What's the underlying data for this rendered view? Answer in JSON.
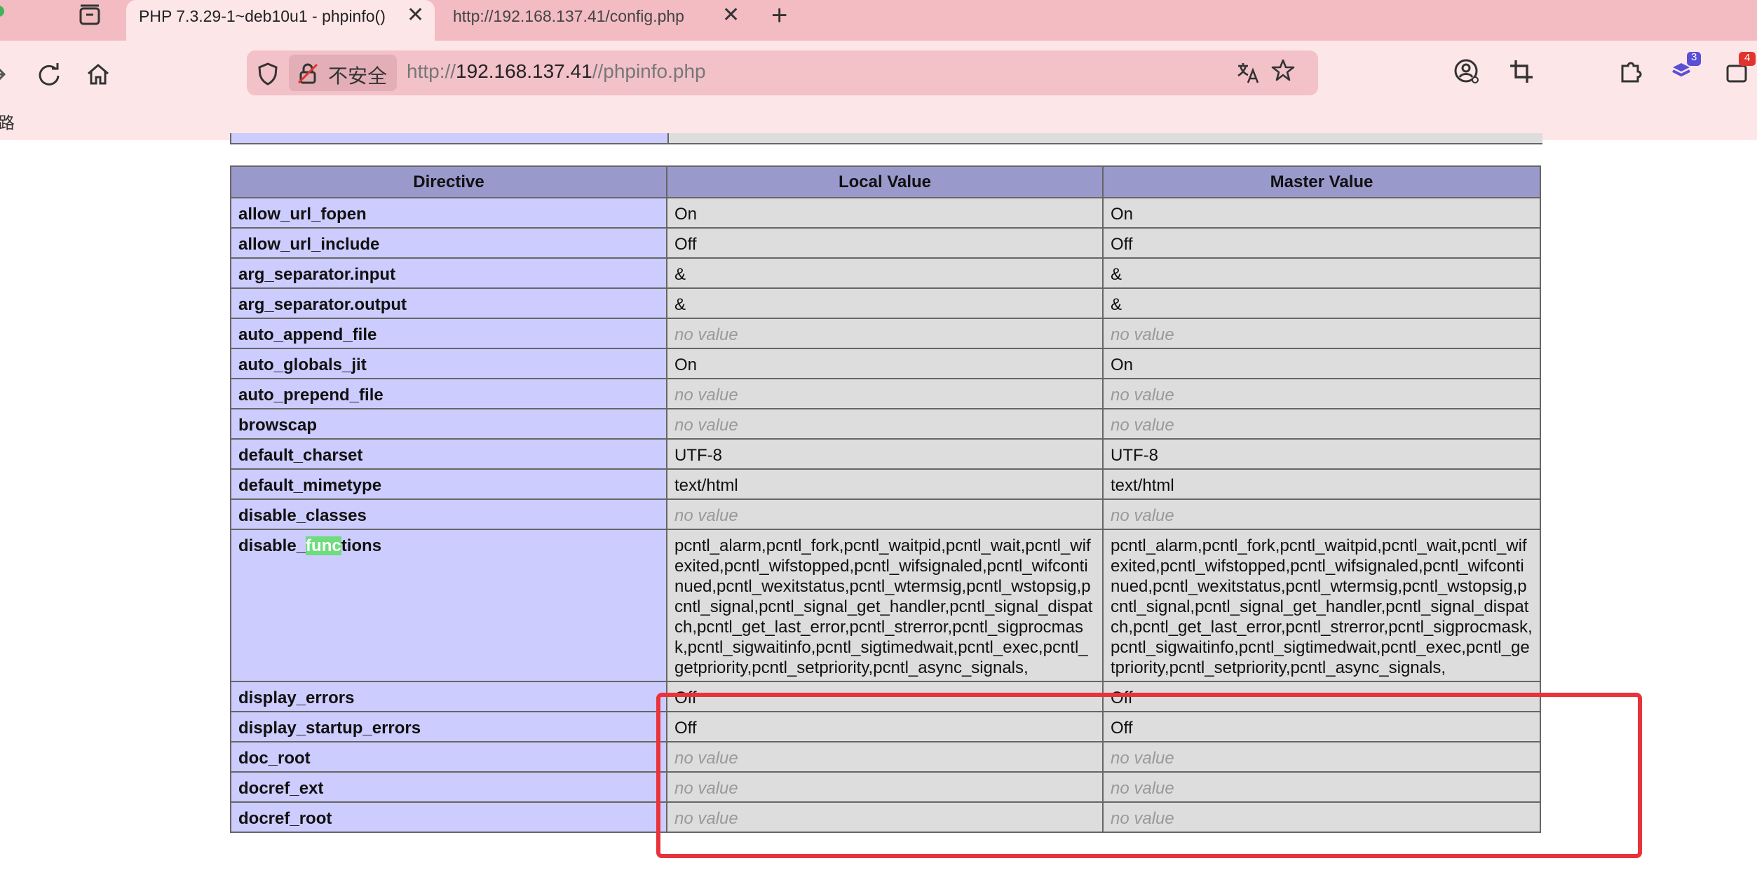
{
  "browser": {
    "active_tab_title": "PHP 7.3.29-1~deb10u1 - phpinfo()",
    "second_tab_title": "http://192.168.137.41/config.php",
    "tab_close_glyph": "✕",
    "new_tab_glyph": "+",
    "security_label": "不安全",
    "url_scheme": "http://",
    "url_host": "192.168.137.41",
    "url_path": "//phpinfo.php",
    "bookmark_partial": "է路",
    "badges": {
      "ext_badge_1": "3",
      "ext_badge_2": "4"
    },
    "colors": {
      "chrome": "#f6c9ce",
      "tab_active": "#fde6e8",
      "badge_blue": "#5b4fd6",
      "badge_red": "#e0342c"
    }
  },
  "table": {
    "headers": [
      "Directive",
      "Local Value",
      "Master Value"
    ],
    "no_value_label": "no value",
    "rows": [
      {
        "directive": "allow_url_fopen",
        "local": "On",
        "master": "On"
      },
      {
        "directive": "allow_url_include",
        "local": "Off",
        "master": "Off"
      },
      {
        "directive": "arg_separator.input",
        "local": "&",
        "master": "&"
      },
      {
        "directive": "arg_separator.output",
        "local": "&",
        "master": "&"
      },
      {
        "directive": "auto_append_file",
        "local": "no value",
        "master": "no value"
      },
      {
        "directive": "auto_globals_jit",
        "local": "On",
        "master": "On"
      },
      {
        "directive": "auto_prepend_file",
        "local": "no value",
        "master": "no value"
      },
      {
        "directive": "browscap",
        "local": "no value",
        "master": "no value"
      },
      {
        "directive": "default_charset",
        "local": "UTF-8",
        "master": "UTF-8"
      },
      {
        "directive": "default_mimetype",
        "local": "text/html",
        "master": "text/html"
      },
      {
        "directive": "disable_classes",
        "local": "no value",
        "master": "no value"
      }
    ],
    "disable_functions": {
      "directive_prefix": "disable_",
      "directive_highlight": "func",
      "directive_suffix": "tions",
      "local": "pcntl_alarm,pcntl_fork,pcntl_waitpid,pcntl_wait,pcntl_wifexited,pcntl_wifstopped,pcntl_wifsignaled,pcntl_wifcontinued,pcntl_wexitstatus,pcntl_wtermsig,pcntl_wstopsig,pcntl_signal,pcntl_signal_get_handler,pcntl_signal_dispatch,pcntl_get_last_error,pcntl_strerror,pcntl_sigprocmask,pcntl_sigwaitinfo,pcntl_sigtimedwait,pcntl_exec,pcntl_getpriority,pcntl_setpriority,pcntl_async_signals,",
      "master": "pcntl_alarm,pcntl_fork,pcntl_waitpid,pcntl_wait,pcntl_wifexited,pcntl_wifstopped,pcntl_wifsignaled,pcntl_wifcontinued,pcntl_wexitstatus,pcntl_wtermsig,pcntl_wstopsig,pcntl_signal,pcntl_signal_get_handler,pcntl_signal_dispatch,pcntl_get_last_error,pcntl_strerror,pcntl_sigprocmask,pcntl_sigwaitinfo,pcntl_sigtimedwait,pcntl_exec,pcntl_getpriority,pcntl_setpriority,pcntl_async_signals,"
    },
    "rows_after": [
      {
        "directive": "display_errors",
        "local": "Off",
        "master": "Off"
      },
      {
        "directive": "display_startup_errors",
        "local": "Off",
        "master": "Off"
      },
      {
        "directive": "doc_root",
        "local": "no value",
        "master": "no value"
      },
      {
        "directive": "docref_ext",
        "local": "no value",
        "master": "no value"
      },
      {
        "directive": "docref_root",
        "local": "no value",
        "master": "no value"
      }
    ],
    "colors": {
      "header": "#9999cc",
      "directive_cell": "#ccccff",
      "value_cell": "#dddddd",
      "highlight_box": "#e8323c",
      "find_highlight": "#6fdc7d"
    }
  }
}
